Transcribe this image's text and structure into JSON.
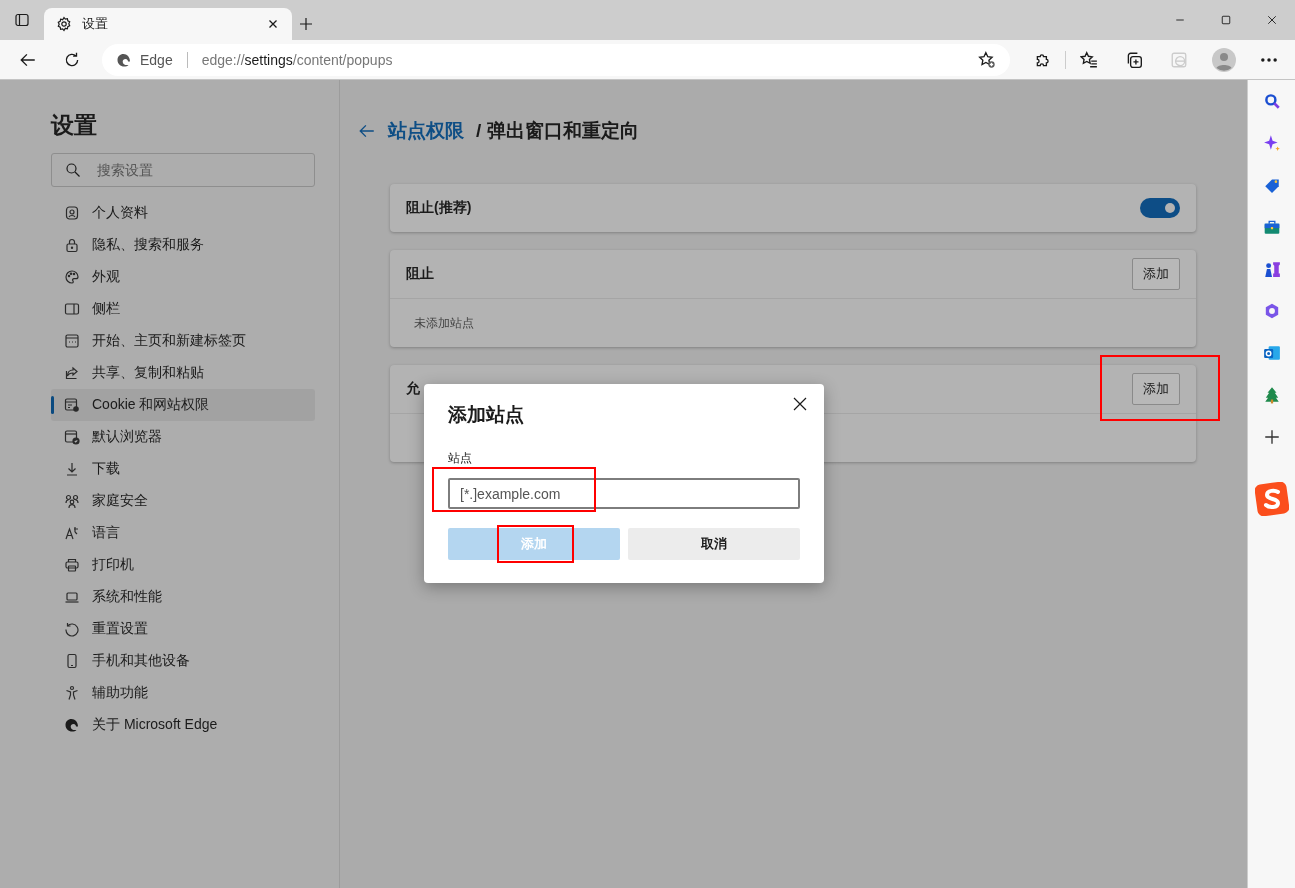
{
  "window": {
    "tab": {
      "title": "设置"
    }
  },
  "address_bar": {
    "site": "Edge",
    "url_prefix": "edge://",
    "url_main": "settings",
    "url_rest": "/content/popups"
  },
  "nav": {
    "title": "设置",
    "search": {
      "placeholder": "搜索设置"
    },
    "items": [
      {
        "label": "个人资料",
        "selected": false
      },
      {
        "label": "隐私、搜索和服务",
        "selected": false
      },
      {
        "label": "外观",
        "selected": false
      },
      {
        "label": "侧栏",
        "selected": false
      },
      {
        "label": "开始、主页和新建标签页",
        "selected": false
      },
      {
        "label": "共享、复制和粘贴",
        "selected": false
      },
      {
        "label": "Cookie 和网站权限",
        "selected": true
      },
      {
        "label": "默认浏览器",
        "selected": false
      },
      {
        "label": "下载",
        "selected": false
      },
      {
        "label": "家庭安全",
        "selected": false
      },
      {
        "label": "语言",
        "selected": false
      },
      {
        "label": "打印机",
        "selected": false
      },
      {
        "label": "系统和性能",
        "selected": false
      },
      {
        "label": "重置设置",
        "selected": false
      },
      {
        "label": "手机和其他设备",
        "selected": false
      },
      {
        "label": "辅助功能",
        "selected": false
      },
      {
        "label": "关于 Microsoft Edge",
        "selected": false
      }
    ]
  },
  "page": {
    "breadcrumb_parent": "站点权限",
    "title": "/ 弹出窗口和重定向",
    "toggle_card": {
      "label": "阻止(推荐)",
      "on": true
    },
    "site_lists": [
      {
        "title": "阻止",
        "button": "添加",
        "empty_text": "未添加站点"
      },
      {
        "title": "允",
        "button": "添加"
      }
    ]
  },
  "dialog": {
    "title": "添加站点",
    "field_label": "站点",
    "field": {
      "placeholder": "[*.]example.com"
    },
    "buttons": [
      {
        "label": "添加",
        "kind": "primary",
        "disabled": true
      },
      {
        "label": "取消",
        "kind": "secondary",
        "disabled": false
      }
    ]
  },
  "highlights": [
    {
      "kind": "frame"
    },
    {
      "kind": "frame"
    },
    {
      "kind": "frame"
    }
  ]
}
